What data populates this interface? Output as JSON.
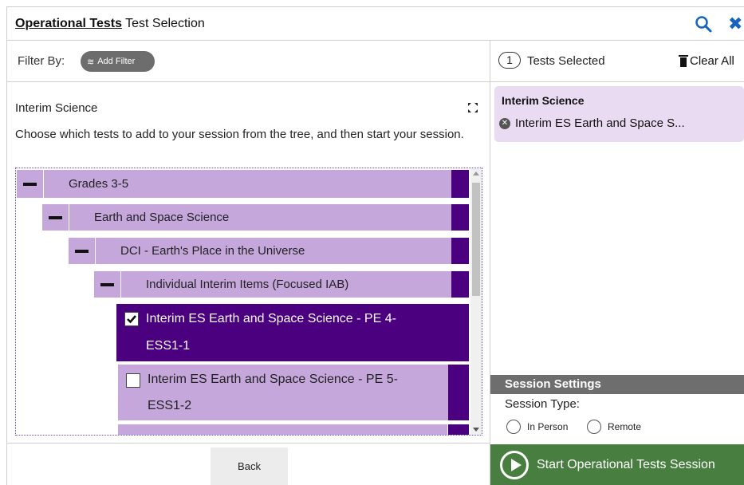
{
  "header": {
    "title_bold": "Operational Tests",
    "title_rest": " Test Selection",
    "search_icon": "search-icon",
    "close_glyph": "✖"
  },
  "filter": {
    "label": "Filter By:",
    "add_filter_icon": "≋",
    "add_filter_label": "Add Filter"
  },
  "content": {
    "section_title": "Interim Science",
    "instructions": "Choose which tests to add to your session from the tree, and then start your session."
  },
  "tree": {
    "nodes": [
      {
        "label": "Grades 3-5",
        "expanded": true
      },
      {
        "label": "Earth and Space Science",
        "expanded": true
      },
      {
        "label": "DCI - Earth's Place in the Universe",
        "expanded": true
      },
      {
        "label": "Individual Interim Items (Focused IAB)",
        "expanded": true
      }
    ],
    "leaves": [
      {
        "line1": "Interim ES Earth and Space Science - PE 4-",
        "line2": "ESS1-1",
        "checked": true
      },
      {
        "line1": "Interim ES Earth and Space Science - PE 5-",
        "line2": "ESS1-2",
        "checked": false
      }
    ]
  },
  "footer": {
    "back_label": "Back"
  },
  "selected": {
    "count": "1",
    "label": "Tests Selected",
    "clear_all": "Clear All",
    "group": "Interim Science",
    "items": [
      "Interim ES Earth and Space S..."
    ]
  },
  "settings": {
    "header": "Session Settings",
    "session_type_label": "Session Type:",
    "options": [
      "In Person",
      "Remote"
    ]
  },
  "start": {
    "label": "Start Operational Tests Session"
  },
  "colors": {
    "tree_row": "#c5a7dc",
    "tree_selected": "#4b007f",
    "selected_card": "#e9dcf2",
    "start_button": "#487e3f",
    "settings_header": "#6e6e6e",
    "accent_blue": "#1565c0"
  }
}
